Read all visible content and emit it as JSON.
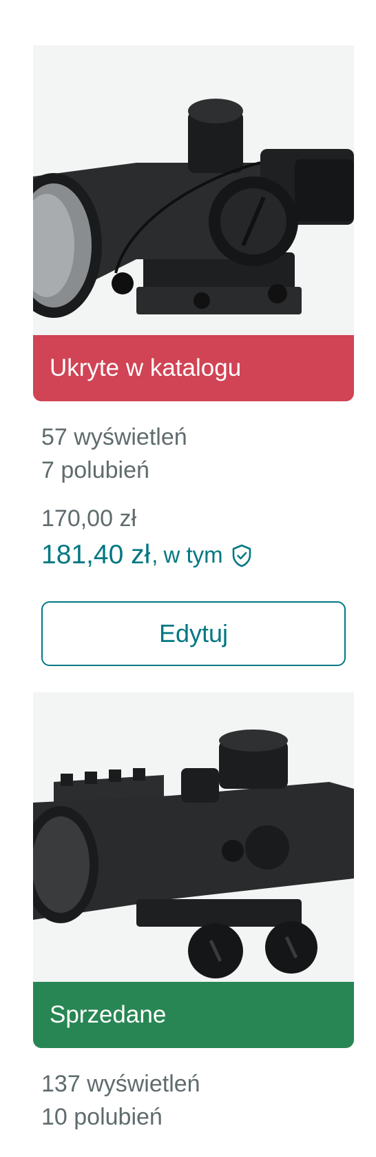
{
  "listings": [
    {
      "image_alt": "rifle-scope-photo",
      "status": {
        "label": "Ukryte w katalogu",
        "color": "#d04455"
      },
      "stats": {
        "views": "57 wyświetleń",
        "likes": "7 polubień"
      },
      "price": {
        "base": "170,00 zł",
        "total": "181,40 zł",
        "separator": ",",
        "including": "w tym",
        "protection_icon": "shield-check-icon"
      },
      "edit_label": "Edytuj"
    },
    {
      "image_alt": "red-dot-scope-photo",
      "status": {
        "label": "Sprzedane",
        "color": "#288654"
      },
      "stats": {
        "views": "137 wyświetleń",
        "likes": "10 polubień"
      }
    }
  ],
  "colors": {
    "accent": "#007782",
    "text_muted": "#5f6b6d",
    "hidden_status": "#d04455",
    "sold_status": "#288654"
  }
}
